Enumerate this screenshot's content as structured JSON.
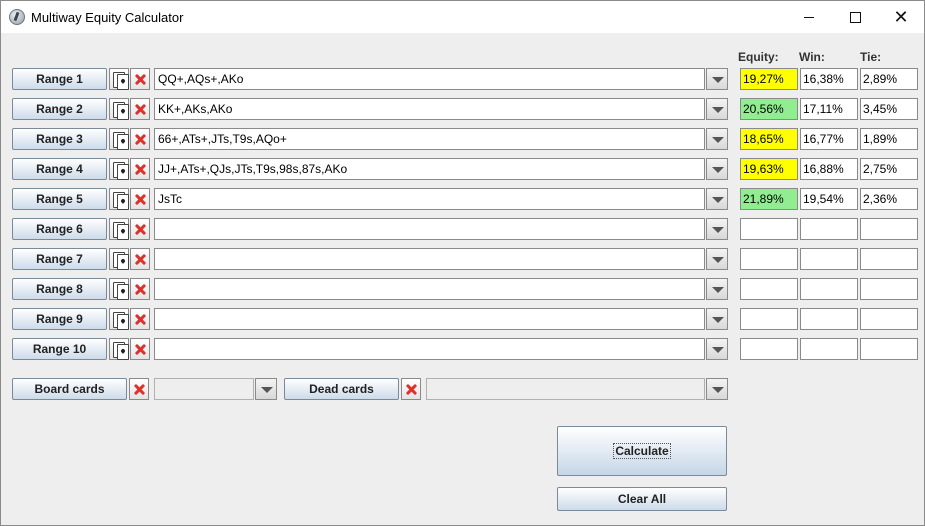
{
  "window": {
    "title": "Multiway Equity Calculator",
    "controls": {
      "minimize": "",
      "maximize": "",
      "close": "✕"
    }
  },
  "headers": {
    "equity": "Equity:",
    "win": "Win:",
    "tie": "Tie:"
  },
  "colors": {
    "equity_yellow": "#ffff00",
    "equity_green": "#90ee90",
    "button_top": "#ffffff",
    "button_bottom": "#cddbea",
    "delete_red": "#e0302a"
  },
  "rows": [
    {
      "label": "Range 1",
      "range": "QQ+,AQs+,AKo",
      "equity": "19,27%",
      "win": "16,38%",
      "tie": "2,89%",
      "highlight": "yellow"
    },
    {
      "label": "Range 2",
      "range": "KK+,AKs,AKo",
      "equity": "20,56%",
      "win": "17,11%",
      "tie": "3,45%",
      "highlight": "green"
    },
    {
      "label": "Range 3",
      "range": "66+,ATs+,JTs,T9s,AQo+",
      "equity": "18,65%",
      "win": "16,77%",
      "tie": "1,89%",
      "highlight": "yellow"
    },
    {
      "label": "Range 4",
      "range": "JJ+,ATs+,QJs,JTs,T9s,98s,87s,AKo",
      "equity": "19,63%",
      "win": "16,88%",
      "tie": "2,75%",
      "highlight": "yellow"
    },
    {
      "label": "Range 5",
      "range": "JsTc",
      "equity": "21,89%",
      "win": "19,54%",
      "tie": "2,36%",
      "highlight": "green"
    },
    {
      "label": "Range 6",
      "range": "",
      "equity": "",
      "win": "",
      "tie": "",
      "highlight": ""
    },
    {
      "label": "Range 7",
      "range": "",
      "equity": "",
      "win": "",
      "tie": "",
      "highlight": ""
    },
    {
      "label": "Range 8",
      "range": "",
      "equity": "",
      "win": "",
      "tie": "",
      "highlight": ""
    },
    {
      "label": "Range 9",
      "range": "",
      "equity": "",
      "win": "",
      "tie": "",
      "highlight": ""
    },
    {
      "label": "Range 10",
      "range": "",
      "equity": "",
      "win": "",
      "tie": "",
      "highlight": ""
    }
  ],
  "board": {
    "label": "Board cards",
    "value": ""
  },
  "dead": {
    "label": "Dead cards",
    "value": ""
  },
  "actions": {
    "calculate": "Calculate",
    "clear_all": "Clear All"
  },
  "icons": {
    "card": "cards-icon",
    "delete": "delete-x-icon",
    "dropdown": "dropdown-arrow-icon",
    "app": "app-icon"
  }
}
